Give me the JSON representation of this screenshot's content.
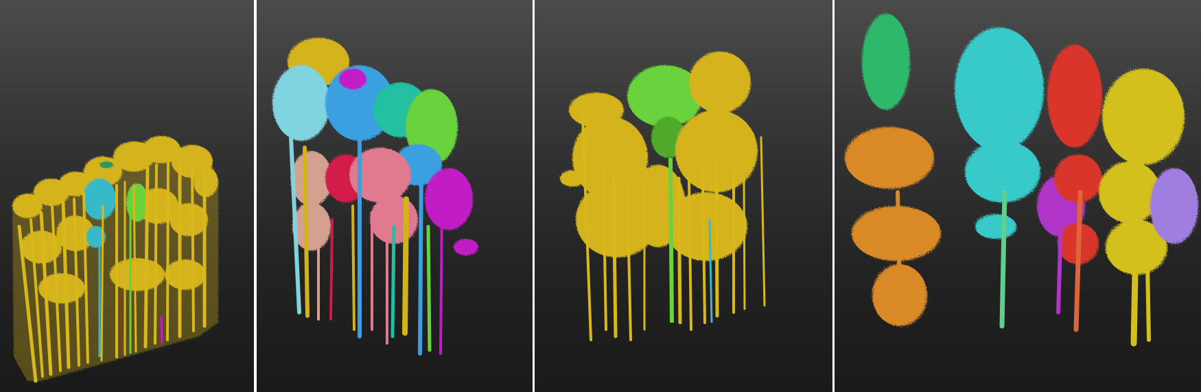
{
  "figure": {
    "background_color": "#2a2a2a",
    "separator_color": "#ffffff",
    "panels": [
      {
        "id": "panel-1",
        "content": "point-cloud-forest-plot-segmentation",
        "dominant_color": "#d4b31a",
        "segment_colors": [
          "#d4b31a",
          "#37b9c9",
          "#69d23c",
          "#d01a4a",
          "#c21ac7"
        ]
      },
      {
        "id": "panel-2",
        "content": "point-cloud-tree-segmentation",
        "dominant_color": "#d4b31a",
        "segment_colors": [
          "#d4b31a",
          "#7fd4e0",
          "#3aa0e0",
          "#e07a8f",
          "#d4a090",
          "#c21ac7",
          "#d01a4a",
          "#69d23c",
          "#22bfa0"
        ]
      },
      {
        "id": "panel-3",
        "content": "point-cloud-tree-segmentation",
        "dominant_color": "#d4b31a",
        "segment_colors": [
          "#d4b31a",
          "#69d23c",
          "#37b9c9"
        ]
      },
      {
        "id": "panel-4",
        "content": "point-cloud-tree-segmentation",
        "dominant_color": "#37c9c9",
        "segment_colors": [
          "#2fb86a",
          "#d98a26",
          "#37c9c9",
          "#d9342a",
          "#b036c9",
          "#d4c01a",
          "#a07ee0"
        ]
      }
    ]
  }
}
